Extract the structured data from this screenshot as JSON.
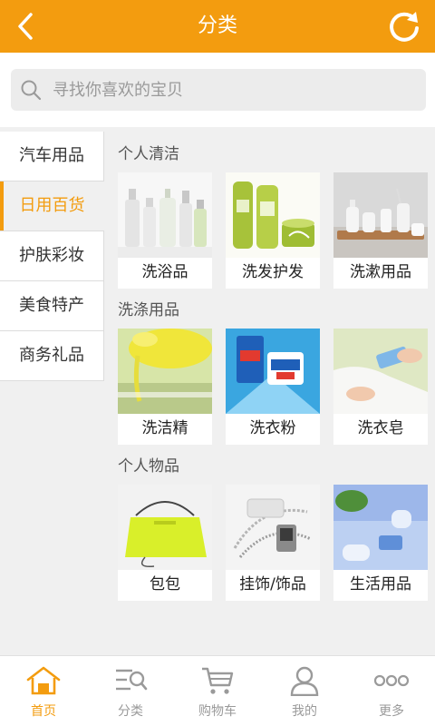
{
  "header": {
    "title": "分类",
    "back_icon": "back-arrow-icon",
    "refresh_icon": "refresh-icon"
  },
  "search": {
    "placeholder": "寻找你喜欢的宝贝",
    "value": "",
    "icon": "search-icon"
  },
  "sidebar": {
    "items": [
      {
        "label": "汽车用品"
      },
      {
        "label": "日用百货"
      },
      {
        "label": "护肤彩妆"
      },
      {
        "label": "美食特产"
      },
      {
        "label": "商务礼品"
      }
    ],
    "active": "日用百货"
  },
  "sections": [
    {
      "title": "个人清洁",
      "items": [
        {
          "label": "洗浴品"
        },
        {
          "label": "洗发护发"
        },
        {
          "label": "洗漱用品"
        }
      ]
    },
    {
      "title": "洗涤用品",
      "items": [
        {
          "label": "洗洁精"
        },
        {
          "label": "洗衣粉"
        },
        {
          "label": "洗衣皂"
        }
      ]
    },
    {
      "title": "个人物品",
      "items": [
        {
          "label": "包包"
        },
        {
          "label": "挂饰/饰品"
        },
        {
          "label": "生活用品"
        }
      ]
    }
  ],
  "tabbar": {
    "items": [
      {
        "label": "首页",
        "icon": "home-icon"
      },
      {
        "label": "分类",
        "icon": "category-search-icon"
      },
      {
        "label": "购物车",
        "icon": "cart-icon"
      },
      {
        "label": "我的",
        "icon": "user-icon"
      },
      {
        "label": "更多",
        "icon": "more-icon"
      }
    ],
    "active": "首页"
  },
  "colors": {
    "accent": "#f39c0f",
    "background": "#f0f0f0",
    "inactive": "#9a9a9a"
  }
}
